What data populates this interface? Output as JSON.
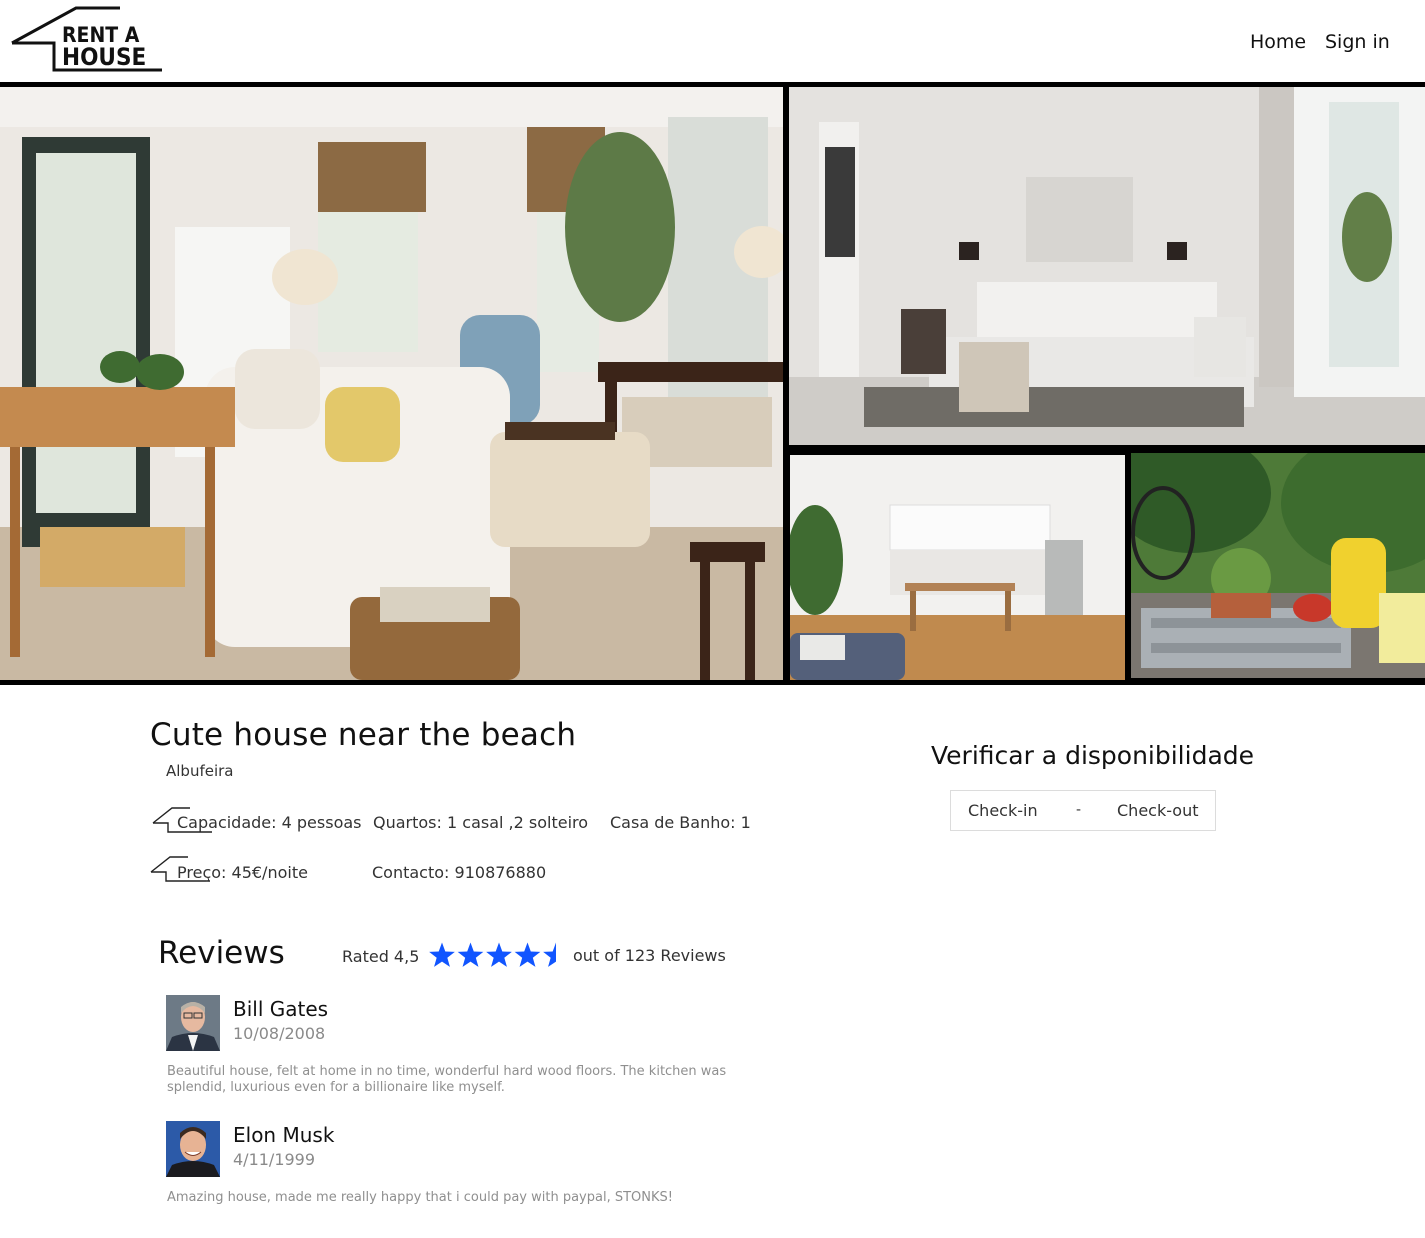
{
  "header": {
    "logo_line1": "RENT A",
    "logo_line2": "HOUSE",
    "nav": {
      "home": "Home",
      "sign_in": "Sign in"
    }
  },
  "listing": {
    "title": "Cute house near the beach",
    "location": "Albufeira",
    "capacity_label": "Capacidade:",
    "capacity_value": "4 pessoas",
    "rooms_label": "Quartos:",
    "rooms_value": "1 casal ,2 solteiro",
    "bath_label": "Casa de Banho:",
    "bath_value": "1",
    "price_label": "Preço:",
    "price_value": "45€/noite",
    "contact_label": "Contacto:",
    "contact_value": "910876880"
  },
  "availability": {
    "title": "Verificar a disponibilidade",
    "check_in": "Check-in",
    "separator": "-",
    "check_out": "Check-out"
  },
  "reviews": {
    "heading": "Reviews",
    "rated_label": "Rated 4,5",
    "rating": 4.5,
    "rating_max": 5,
    "star_color": "#1155ff",
    "count_label": "out of 123 Reviews",
    "items": [
      {
        "name": "Bill Gates",
        "date": "10/08/2008",
        "text": "Beautiful house, felt at home in no time, wonderful hard wood floors. The kitchen was splendid, luxurious even for a billionaire like myself."
      },
      {
        "name": "Elon Musk",
        "date": "4/11/1999",
        "text": "Amazing house, made me really happy that i could pay with paypal, STONKS!"
      }
    ]
  }
}
